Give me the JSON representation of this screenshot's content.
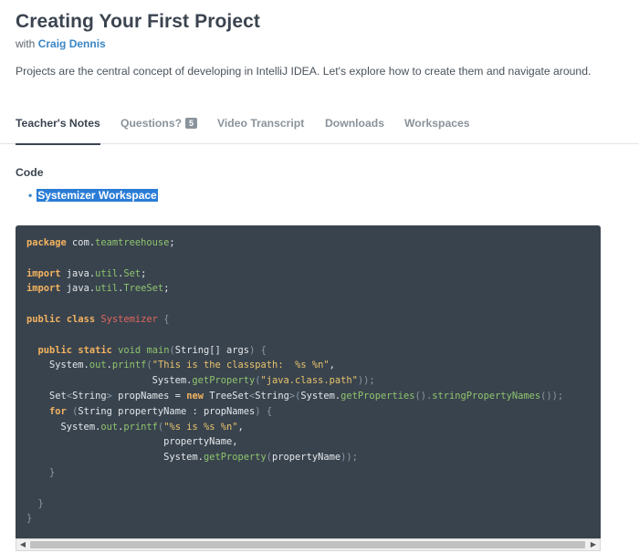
{
  "header": {
    "title": "Creating Your First Project",
    "with_text": "with",
    "author": "Craig Dennis",
    "description": "Projects are the central concept of developing in IntelliJ IDEA. Let's explore how to create them and navigate around."
  },
  "tabs": [
    {
      "label": "Teacher's Notes",
      "active": true
    },
    {
      "label": "Questions?",
      "badge": "5"
    },
    {
      "label": "Video Transcript"
    },
    {
      "label": "Downloads"
    },
    {
      "label": "Workspaces"
    }
  ],
  "notes": {
    "section_title": "Code",
    "links": [
      {
        "label": "Systemizer Workspace",
        "selected": true
      }
    ]
  },
  "code": {
    "lines": [
      "package com.teamtreehouse;",
      "",
      "import java.util.Set;",
      "import java.util.TreeSet;",
      "",
      "public class Systemizer {",
      "",
      "  public static void main(String[] args) {",
      "    System.out.printf(\"This is the classpath:  %s %n\",",
      "                      System.getProperty(\"java.class.path\"));",
      "    Set<String> propNames = new TreeSet<String>(System.getProperties().stringPropertyNames());",
      "    for (String propertyName : propNames) {",
      "      System.out.printf(\"%s is %s %n\",",
      "                        propertyName,",
      "                        System.getProperty(propertyName));",
      "    }",
      "",
      "  }",
      "}"
    ]
  },
  "colors": {
    "code_background": "#39434e",
    "link_highlight": "#2a7cd6",
    "author_link": "#3b86c4",
    "active_tab": "#3b4450"
  }
}
